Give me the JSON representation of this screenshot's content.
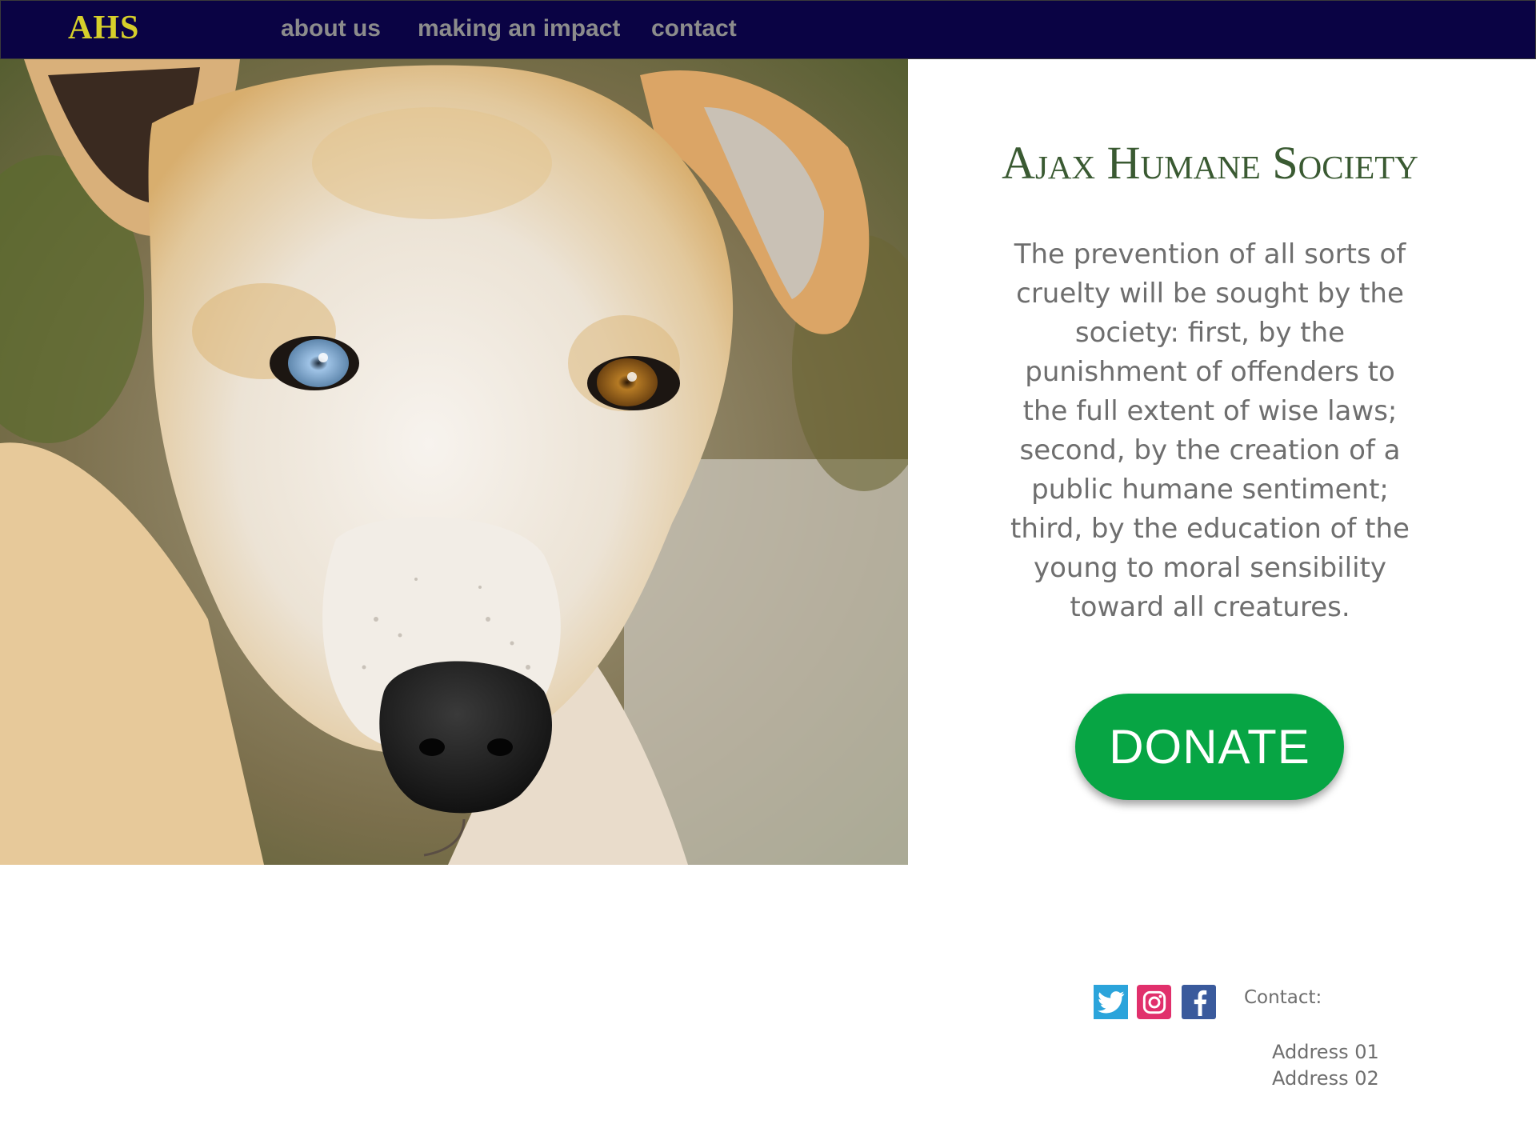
{
  "nav": {
    "logo": "AHS",
    "links": [
      "about us",
      "making an impact",
      "contact"
    ]
  },
  "hero": {
    "title": "Ajax Humane Society",
    "mission": "The prevention of all sorts of cruelty will be sought by the society: first, by the punishment of offenders to the full extent of wise laws; second, by the creation of a public humane sentiment; third, by the education of the young to moral sensibility toward all creatures.",
    "donate_label": "DONATE"
  },
  "footer": {
    "social_icons": [
      "twitter-icon",
      "instagram-icon",
      "facebook-icon"
    ],
    "contact_label": "Contact:",
    "address_lines": [
      "Address 01",
      "Address 02"
    ]
  },
  "colors": {
    "nav_background": "#0a0344",
    "logo": "#d6cf2a",
    "nav_link": "#8c8c8c",
    "title": "#3a5a32",
    "body_text": "#6e6e6e",
    "donate": "#07a544",
    "twitter": "#2ba4db",
    "instagram": "#e1306c",
    "facebook": "#3a5a9c"
  }
}
